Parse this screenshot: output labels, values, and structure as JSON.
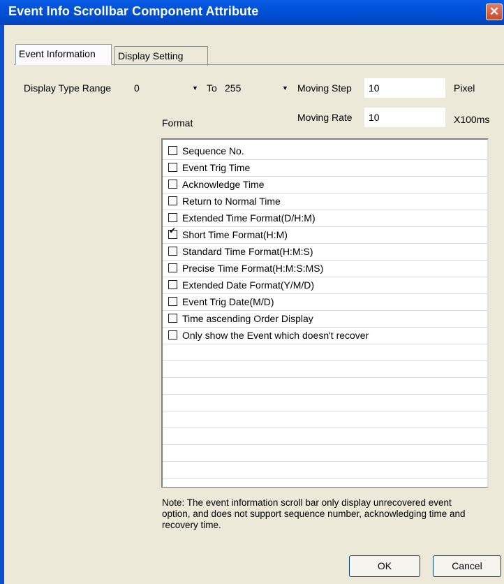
{
  "window": {
    "title": "Event Info Scrollbar Component Attribute",
    "close_glyph": "✕"
  },
  "tabs": [
    {
      "label": "Event Information"
    },
    {
      "label": "Display Setting"
    }
  ],
  "display_range": {
    "label": "Display Type Range",
    "from_value": "0",
    "to_label": "To",
    "to_value": "255",
    "dropdown_glyph": "▼"
  },
  "moving_step": {
    "label": "Moving Step",
    "value": "10",
    "unit": "Pixel"
  },
  "moving_rate": {
    "label": "Moving Rate",
    "value": "10",
    "unit": "X100ms"
  },
  "format": {
    "label": "Format",
    "items": [
      {
        "label": "Sequence No.",
        "checked": false
      },
      {
        "label": "Event Trig Time",
        "checked": false
      },
      {
        "label": "Acknowledge Time",
        "checked": false
      },
      {
        "label": "Return to Normal Time",
        "checked": false
      },
      {
        "label": "Extended Time Format(D/H:M)",
        "checked": false
      },
      {
        "label": "Short Time Format(H:M)",
        "checked": true
      },
      {
        "label": "Standard Time Format(H:M:S)",
        "checked": false
      },
      {
        "label": "Precise Time Format(H:M:S:MS)",
        "checked": false
      },
      {
        "label": "Extended Date Format(Y/M/D)",
        "checked": false
      },
      {
        "label": "Event Trig Date(M/D)",
        "checked": false
      },
      {
        "label": "Time ascending Order Display",
        "checked": false
      },
      {
        "label": "Only show the Event which doesn't recover",
        "checked": false
      }
    ]
  },
  "note": "Note: The event information scroll bar only display unrecovered event option, and does not support sequence number, acknowledging time and recovery time.",
  "buttons": {
    "ok": "OK",
    "cancel": "Cancel"
  }
}
